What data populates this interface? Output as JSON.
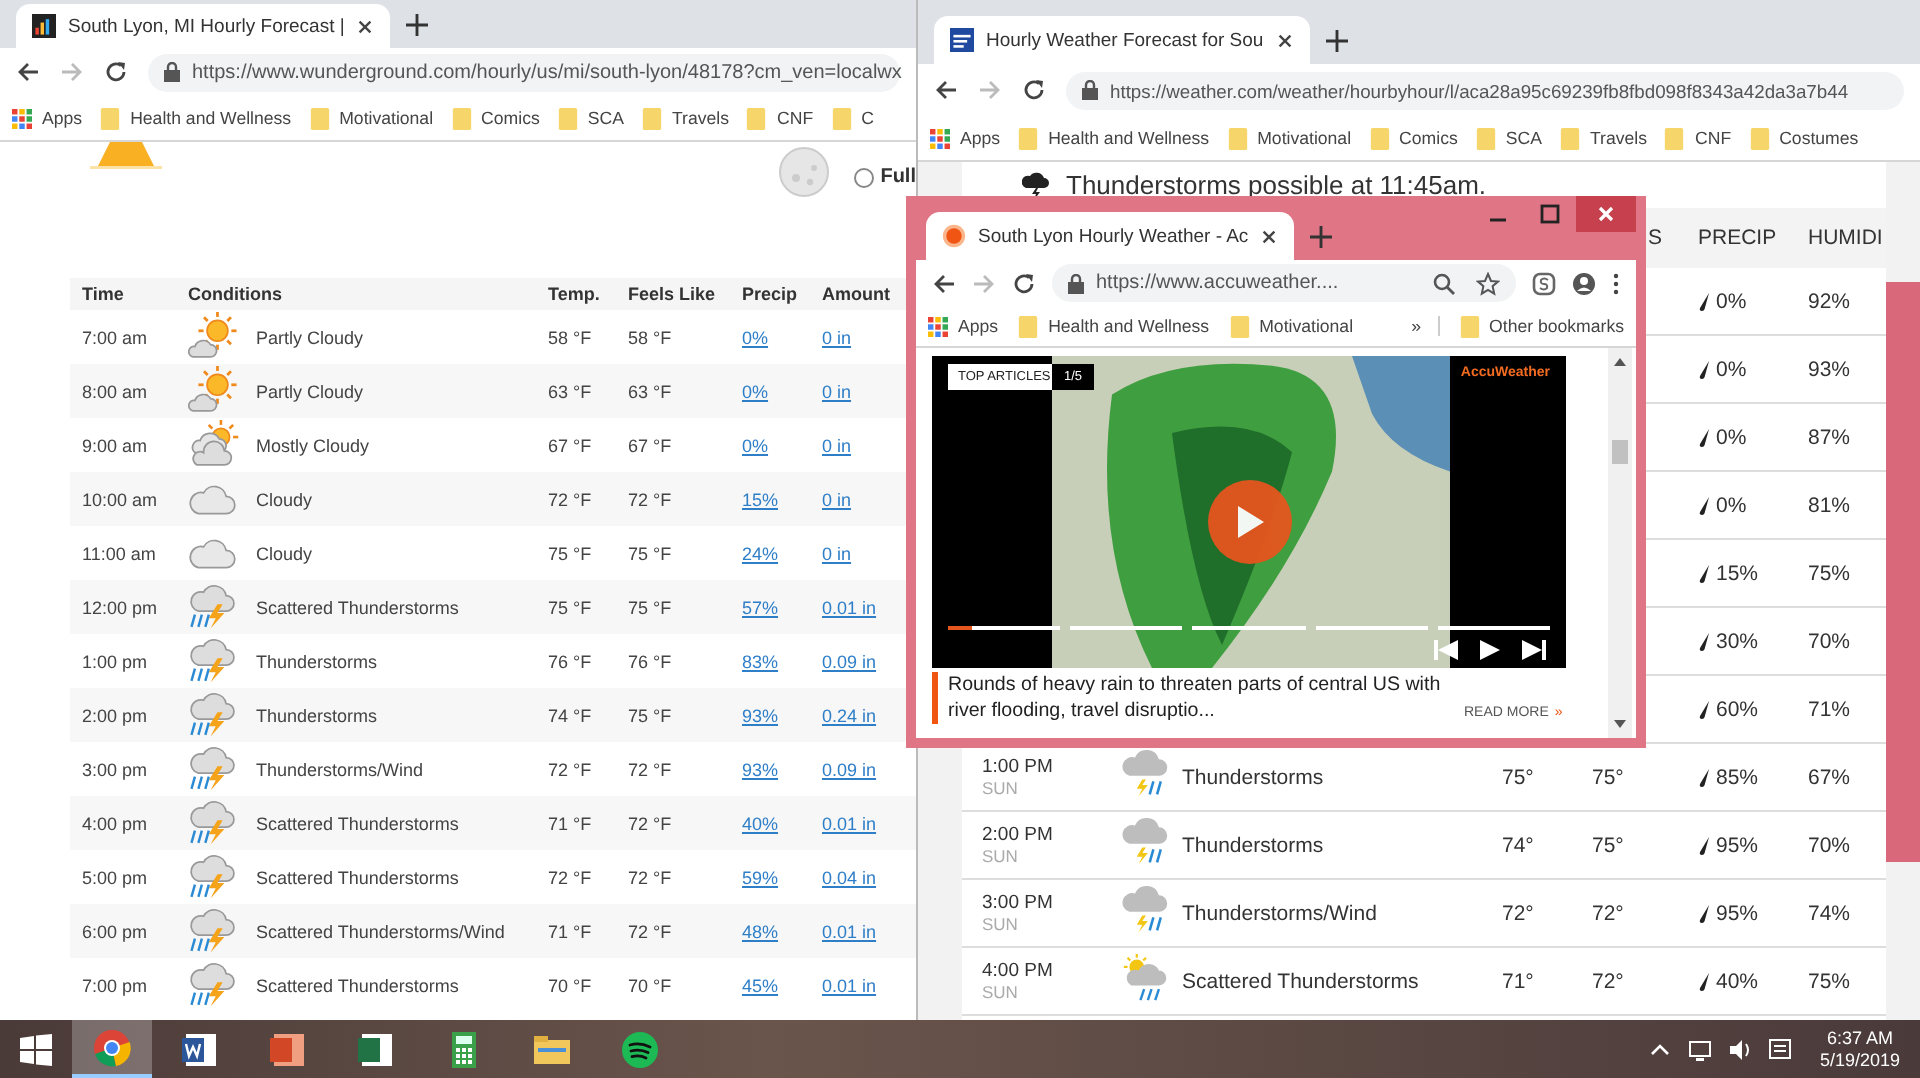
{
  "wunderground_window": {
    "tabs": [
      {
        "title": "South Lyon, MI Hourly Forecast |",
        "selected": true
      }
    ],
    "url": "https://www.wunderground.com/hourly/us/mi/south-lyon/48178?cm_ven=localwx",
    "bookmarks": [
      {
        "label": "Apps",
        "kind": "apps"
      },
      {
        "label": "Health and Wellness",
        "kind": "folder"
      },
      {
        "label": "Motivational",
        "kind": "folder"
      },
      {
        "label": "Comics",
        "kind": "folder"
      },
      {
        "label": "SCA",
        "kind": "folder"
      },
      {
        "label": "Travels",
        "kind": "folder"
      },
      {
        "label": "CNF",
        "kind": "folder"
      },
      {
        "label": "C",
        "kind": "folder"
      }
    ],
    "moon_phase_option": {
      "label": "Full",
      "selected": false
    },
    "table": {
      "columns": [
        "Time",
        "Conditions",
        "Temp.",
        "Feels Like",
        "Precip",
        "Amount"
      ],
      "rows": [
        {
          "time": "7:00 am",
          "kind": "partly_cloudy",
          "conditions": "Partly Cloudy",
          "temp": "58 °F",
          "feels_like": "58 °F",
          "precip": "0%",
          "amount": "0 in"
        },
        {
          "time": "8:00 am",
          "kind": "partly_cloudy",
          "conditions": "Partly Cloudy",
          "temp": "63 °F",
          "feels_like": "63 °F",
          "precip": "0%",
          "amount": "0 in"
        },
        {
          "time": "9:00 am",
          "kind": "mostly_cloudy",
          "conditions": "Mostly Cloudy",
          "temp": "67 °F",
          "feels_like": "67 °F",
          "precip": "0%",
          "amount": "0 in"
        },
        {
          "time": "10:00 am",
          "kind": "cloudy",
          "conditions": "Cloudy",
          "temp": "72 °F",
          "feels_like": "72 °F",
          "precip": "15%",
          "amount": "0 in"
        },
        {
          "time": "11:00 am",
          "kind": "cloudy",
          "conditions": "Cloudy",
          "temp": "75 °F",
          "feels_like": "75 °F",
          "precip": "24%",
          "amount": "0 in"
        },
        {
          "time": "12:00 pm",
          "kind": "storm",
          "conditions": "Scattered Thunderstorms",
          "temp": "75 °F",
          "feels_like": "75 °F",
          "precip": "57%",
          "amount": "0.01 in"
        },
        {
          "time": "1:00 pm",
          "kind": "storm",
          "conditions": "Thunderstorms",
          "temp": "76 °F",
          "feels_like": "76 °F",
          "precip": "83%",
          "amount": "0.09 in"
        },
        {
          "time": "2:00 pm",
          "kind": "storm",
          "conditions": "Thunderstorms",
          "temp": "74 °F",
          "feels_like": "75 °F",
          "precip": "93%",
          "amount": "0.24 in"
        },
        {
          "time": "3:00 pm",
          "kind": "storm",
          "conditions": "Thunderstorms/Wind",
          "temp": "72 °F",
          "feels_like": "72 °F",
          "precip": "93%",
          "amount": "0.09 in"
        },
        {
          "time": "4:00 pm",
          "kind": "storm",
          "conditions": "Scattered Thunderstorms",
          "temp": "71 °F",
          "feels_like": "72 °F",
          "precip": "40%",
          "amount": "0.01 in"
        },
        {
          "time": "5:00 pm",
          "kind": "storm",
          "conditions": "Scattered Thunderstorms",
          "temp": "72 °F",
          "feels_like": "72 °F",
          "precip": "59%",
          "amount": "0.04 in"
        },
        {
          "time": "6:00 pm",
          "kind": "storm",
          "conditions": "Scattered Thunderstorms/Wind",
          "temp": "71 °F",
          "feels_like": "72 °F",
          "precip": "48%",
          "amount": "0.01 in"
        },
        {
          "time": "7:00 pm",
          "kind": "storm",
          "conditions": "Scattered Thunderstorms",
          "temp": "70 °F",
          "feels_like": "70 °F",
          "precip": "45%",
          "amount": "0.01 in"
        }
      ]
    }
  },
  "weather_com_window": {
    "tabs": [
      {
        "title": "Hourly Weather Forecast for Sou",
        "selected": true
      }
    ],
    "url": "https://weather.com/weather/hourbyhour/l/aca28a95c69239fb8fbd098f8343a42da3a7b44",
    "bookmarks": [
      {
        "label": "Apps",
        "kind": "apps"
      },
      {
        "label": "Health and Wellness",
        "kind": "folder"
      },
      {
        "label": "Motivational",
        "kind": "folder"
      },
      {
        "label": "Comics",
        "kind": "folder"
      },
      {
        "label": "SCA",
        "kind": "folder"
      },
      {
        "label": "Travels",
        "kind": "folder"
      },
      {
        "label": "CNF",
        "kind": "folder"
      },
      {
        "label": "Costumes",
        "kind": "folder"
      }
    ],
    "alert": "Thunderstorms possible at 11:45am.",
    "table": {
      "columns": [
        "S",
        "PRECIP",
        "HUMIDI"
      ],
      "rows": [
        {
          "precip": "0%",
          "humidity": "92%"
        },
        {
          "precip": "0%",
          "humidity": "93%"
        },
        {
          "precip": "0%",
          "humidity": "87%"
        },
        {
          "precip": "0%",
          "humidity": "81%"
        },
        {
          "precip": "15%",
          "humidity": "75%"
        },
        {
          "precip": "30%",
          "humidity": "70%"
        },
        {
          "precip": "60%",
          "humidity": "71%"
        },
        {
          "time": "1:00 PM",
          "day": "SUN",
          "kind": "storm",
          "conditions": "Thunderstorms",
          "temp": "75°",
          "feels": "75°",
          "precip": "85%",
          "humidity": "67%"
        },
        {
          "time": "2:00 PM",
          "day": "SUN",
          "kind": "storm",
          "conditions": "Thunderstorms",
          "temp": "74°",
          "feels": "75°",
          "precip": "95%",
          "humidity": "70%"
        },
        {
          "time": "3:00 PM",
          "day": "SUN",
          "kind": "storm",
          "conditions": "Thunderstorms/Wind",
          "temp": "72°",
          "feels": "72°",
          "precip": "95%",
          "humidity": "74%"
        },
        {
          "time": "4:00 PM",
          "day": "SUN",
          "kind": "sun_storm",
          "conditions": "Scattered Thunderstorms",
          "temp": "71°",
          "feels": "72°",
          "precip": "40%",
          "humidity": "75%"
        }
      ]
    }
  },
  "accuweather_window": {
    "tabs": [
      {
        "title": "South Lyon Hourly Weather - Ac",
        "selected": true
      }
    ],
    "url": "https://www.accuweather....",
    "bookmarks": [
      {
        "label": "Apps",
        "kind": "apps"
      },
      {
        "label": "Health and Wellness",
        "kind": "folder"
      },
      {
        "label": "Motivational",
        "kind": "folder"
      },
      {
        "label": "»",
        "kind": "overflow"
      },
      {
        "label": "Other bookmarks",
        "kind": "folder"
      }
    ],
    "video": {
      "badge": "TOP ARTICLES",
      "counter": "1/5",
      "logo": "AccuWeather",
      "progress": {
        "level": 0.22
      }
    },
    "article": {
      "headline": "Rounds of heavy rain to threaten parts of central US with river flooding, travel disruptio...",
      "read_more": "READ MORE",
      "read_more_icon": "»"
    }
  },
  "taskbar": {
    "apps": [
      {
        "kind": "chrome",
        "selected": true
      },
      {
        "kind": "word",
        "selected": false
      },
      {
        "kind": "powerpoint",
        "selected": false
      },
      {
        "kind": "excel",
        "selected": false
      },
      {
        "kind": "calculator",
        "selected": false
      },
      {
        "kind": "files",
        "selected": false
      },
      {
        "kind": "spotify",
        "selected": false
      }
    ],
    "time": "6:37 AM",
    "date": "5/19/2019"
  }
}
